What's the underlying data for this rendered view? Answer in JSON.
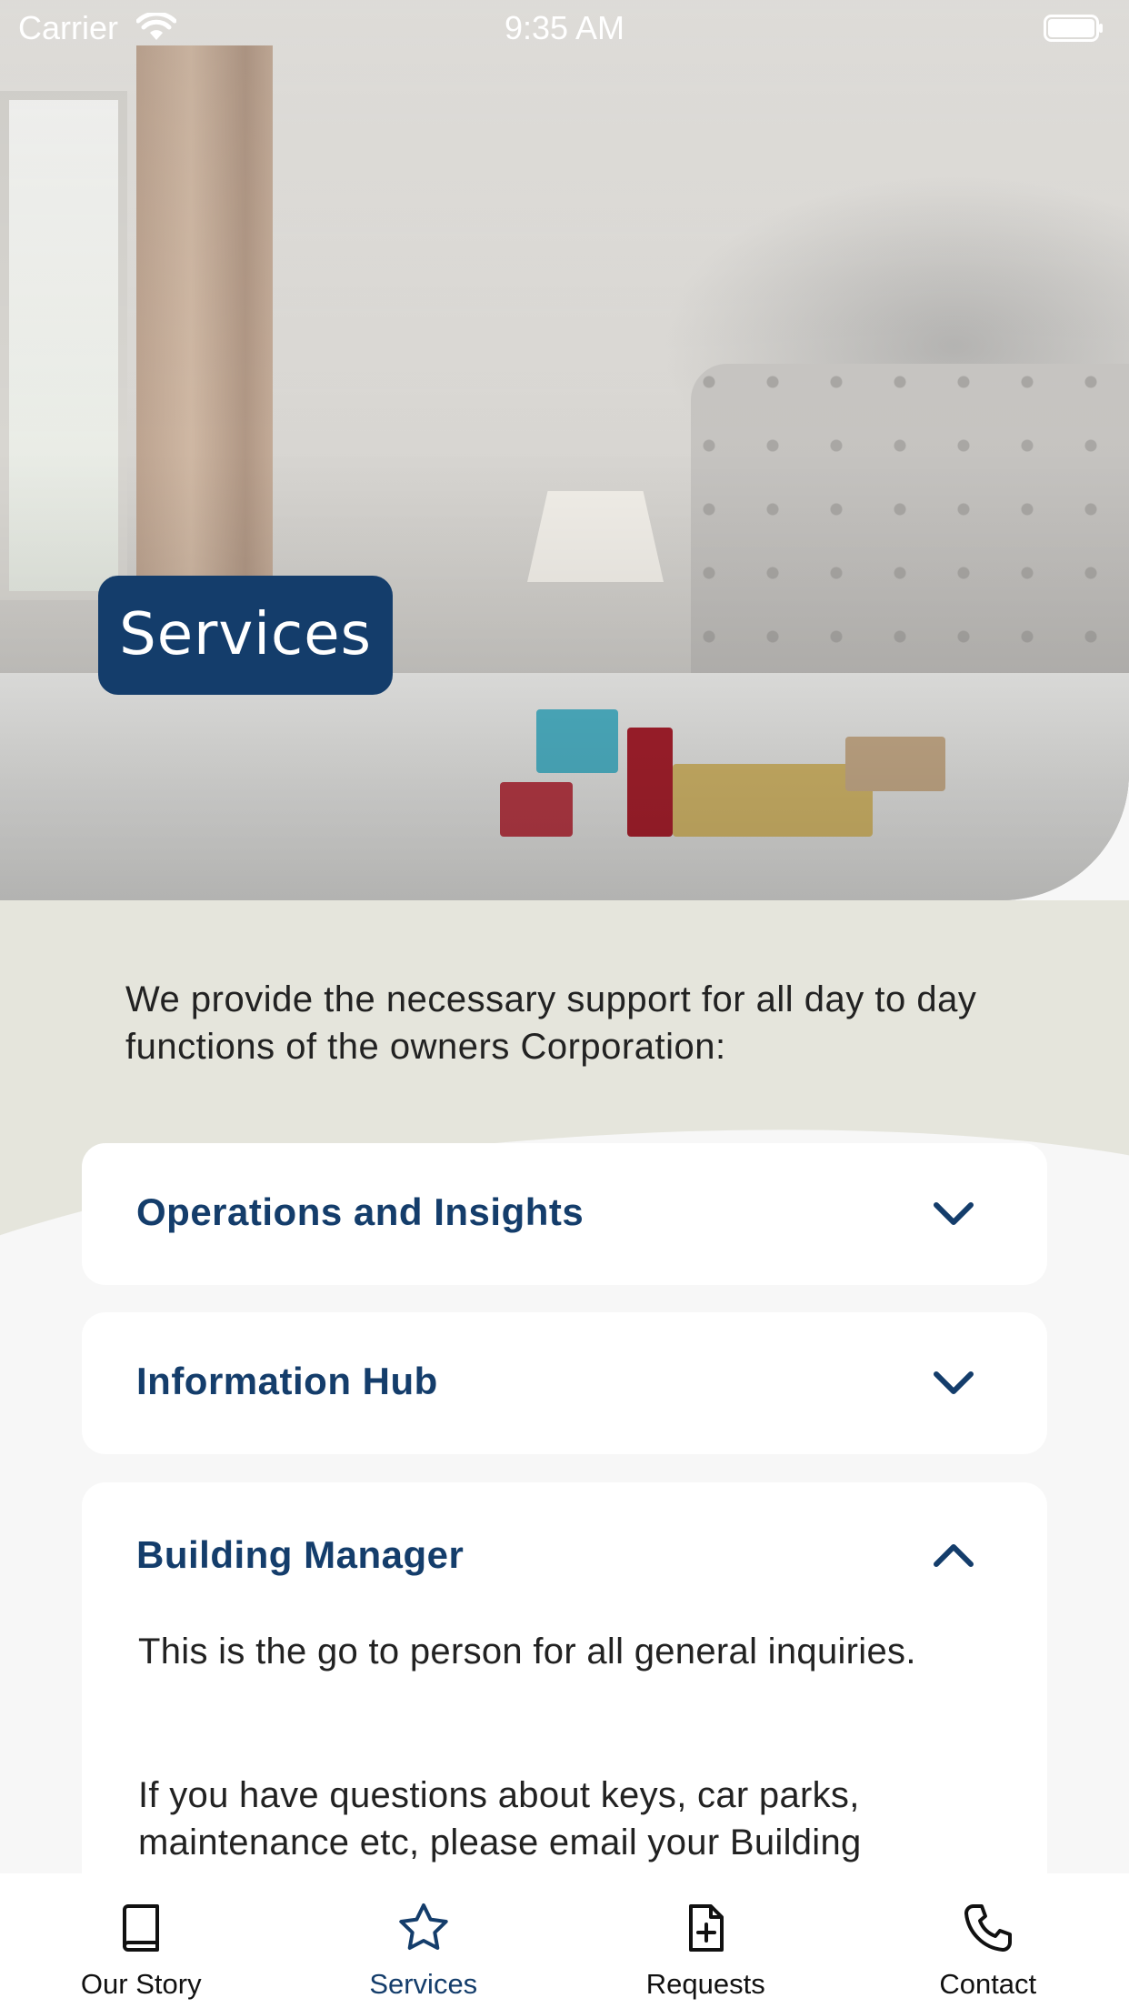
{
  "status_bar": {
    "carrier": "Carrier",
    "time": "9:35 AM"
  },
  "hero": {
    "badge_label": "Services"
  },
  "intro_text": "We provide the necessary support for all day to day functions of the owners Corporation:",
  "accordion": [
    {
      "title": "Operations and Insights",
      "expanded": false,
      "icon": "chevron-down-icon"
    },
    {
      "title": "Information Hub",
      "expanded": false,
      "icon": "chevron-down-icon"
    },
    {
      "title": "Building Manager",
      "expanded": true,
      "icon": "chevron-up-icon",
      "body_1": "This is the go to person for all general inquiries.",
      "body_2": "If you have questions about keys, car parks, maintenance etc, please email your Building"
    }
  ],
  "tab_bar": {
    "tabs": [
      {
        "label": "Our Story",
        "icon": "book-icon",
        "active": false
      },
      {
        "label": "Services",
        "icon": "star-icon",
        "active": true
      },
      {
        "label": "Requests",
        "icon": "file-plus-icon",
        "active": false
      },
      {
        "label": "Contact",
        "icon": "phone-icon",
        "active": false
      }
    ]
  },
  "colors": {
    "brand_navy": "#143d6b",
    "content_bg": "#e5e5dc",
    "card_bg": "#ffffff"
  }
}
